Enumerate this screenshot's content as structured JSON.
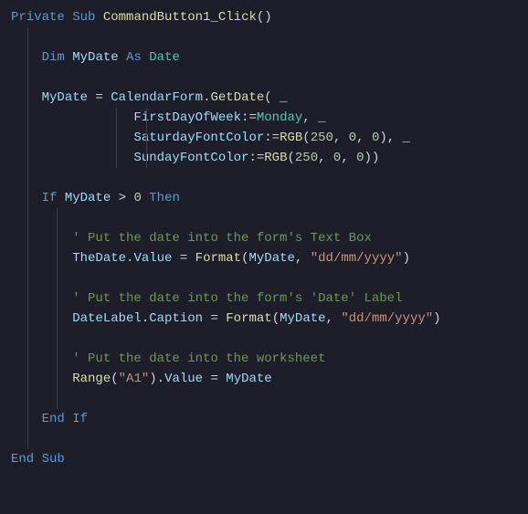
{
  "code": {
    "l1": {
      "t1": "Private",
      "t2": "Sub",
      "t3": "CommandButton1_Click",
      "t4": "()"
    },
    "l3": {
      "t1": "Dim",
      "t2": "MyDate",
      "t3": "As",
      "t4": "Date"
    },
    "l5": {
      "t1": "MyDate",
      "t2": " = ",
      "t3": "CalendarForm",
      "t4": ".",
      "t5": "GetDate",
      "t6": "( _"
    },
    "l6": {
      "t1": "FirstDayOfWeek",
      "t2": ":=",
      "t3": "Monday",
      "t4": ", _"
    },
    "l7": {
      "t1": "SaturdayFontColor",
      "t2": ":=",
      "t3": "RGB",
      "t4": "(",
      "t5": "250",
      "t6": ", ",
      "t7": "0",
      "t8": ", ",
      "t9": "0",
      "t10": "), _"
    },
    "l8": {
      "t1": "SundayFontColor",
      "t2": ":=",
      "t3": "RGB",
      "t4": "(",
      "t5": "250",
      "t6": ", ",
      "t7": "0",
      "t8": ", ",
      "t9": "0",
      "t10": "))"
    },
    "l10": {
      "t1": "If",
      "t2": "MyDate",
      "t3": " > ",
      "t4": "0",
      "t5": "Then"
    },
    "l12": {
      "t1": "' Put the date into the form's Text Box"
    },
    "l13": {
      "t1": "TheDate",
      "t2": ".",
      "t3": "Value",
      "t4": " = ",
      "t5": "Format",
      "t6": "(",
      "t7": "MyDate",
      "t8": ", ",
      "t9": "\"dd/mm/yyyy\"",
      "t10": ")"
    },
    "l15": {
      "t1": "' Put the date into the form's 'Date' Label"
    },
    "l16": {
      "t1": "DateLabel",
      "t2": ".",
      "t3": "Caption",
      "t4": " = ",
      "t5": "Format",
      "t6": "(",
      "t7": "MyDate",
      "t8": ", ",
      "t9": "\"dd/mm/yyyy\"",
      "t10": ")"
    },
    "l18": {
      "t1": "' Put the date into the worksheet"
    },
    "l19": {
      "t1": "Range",
      "t2": "(",
      "t3": "\"A1\"",
      "t4": ").",
      "t5": "Value",
      "t6": " = ",
      "t7": "MyDate"
    },
    "l21": {
      "t1": "End",
      "t2": "If"
    },
    "l23": {
      "t1": "End",
      "t2": "Sub"
    }
  }
}
